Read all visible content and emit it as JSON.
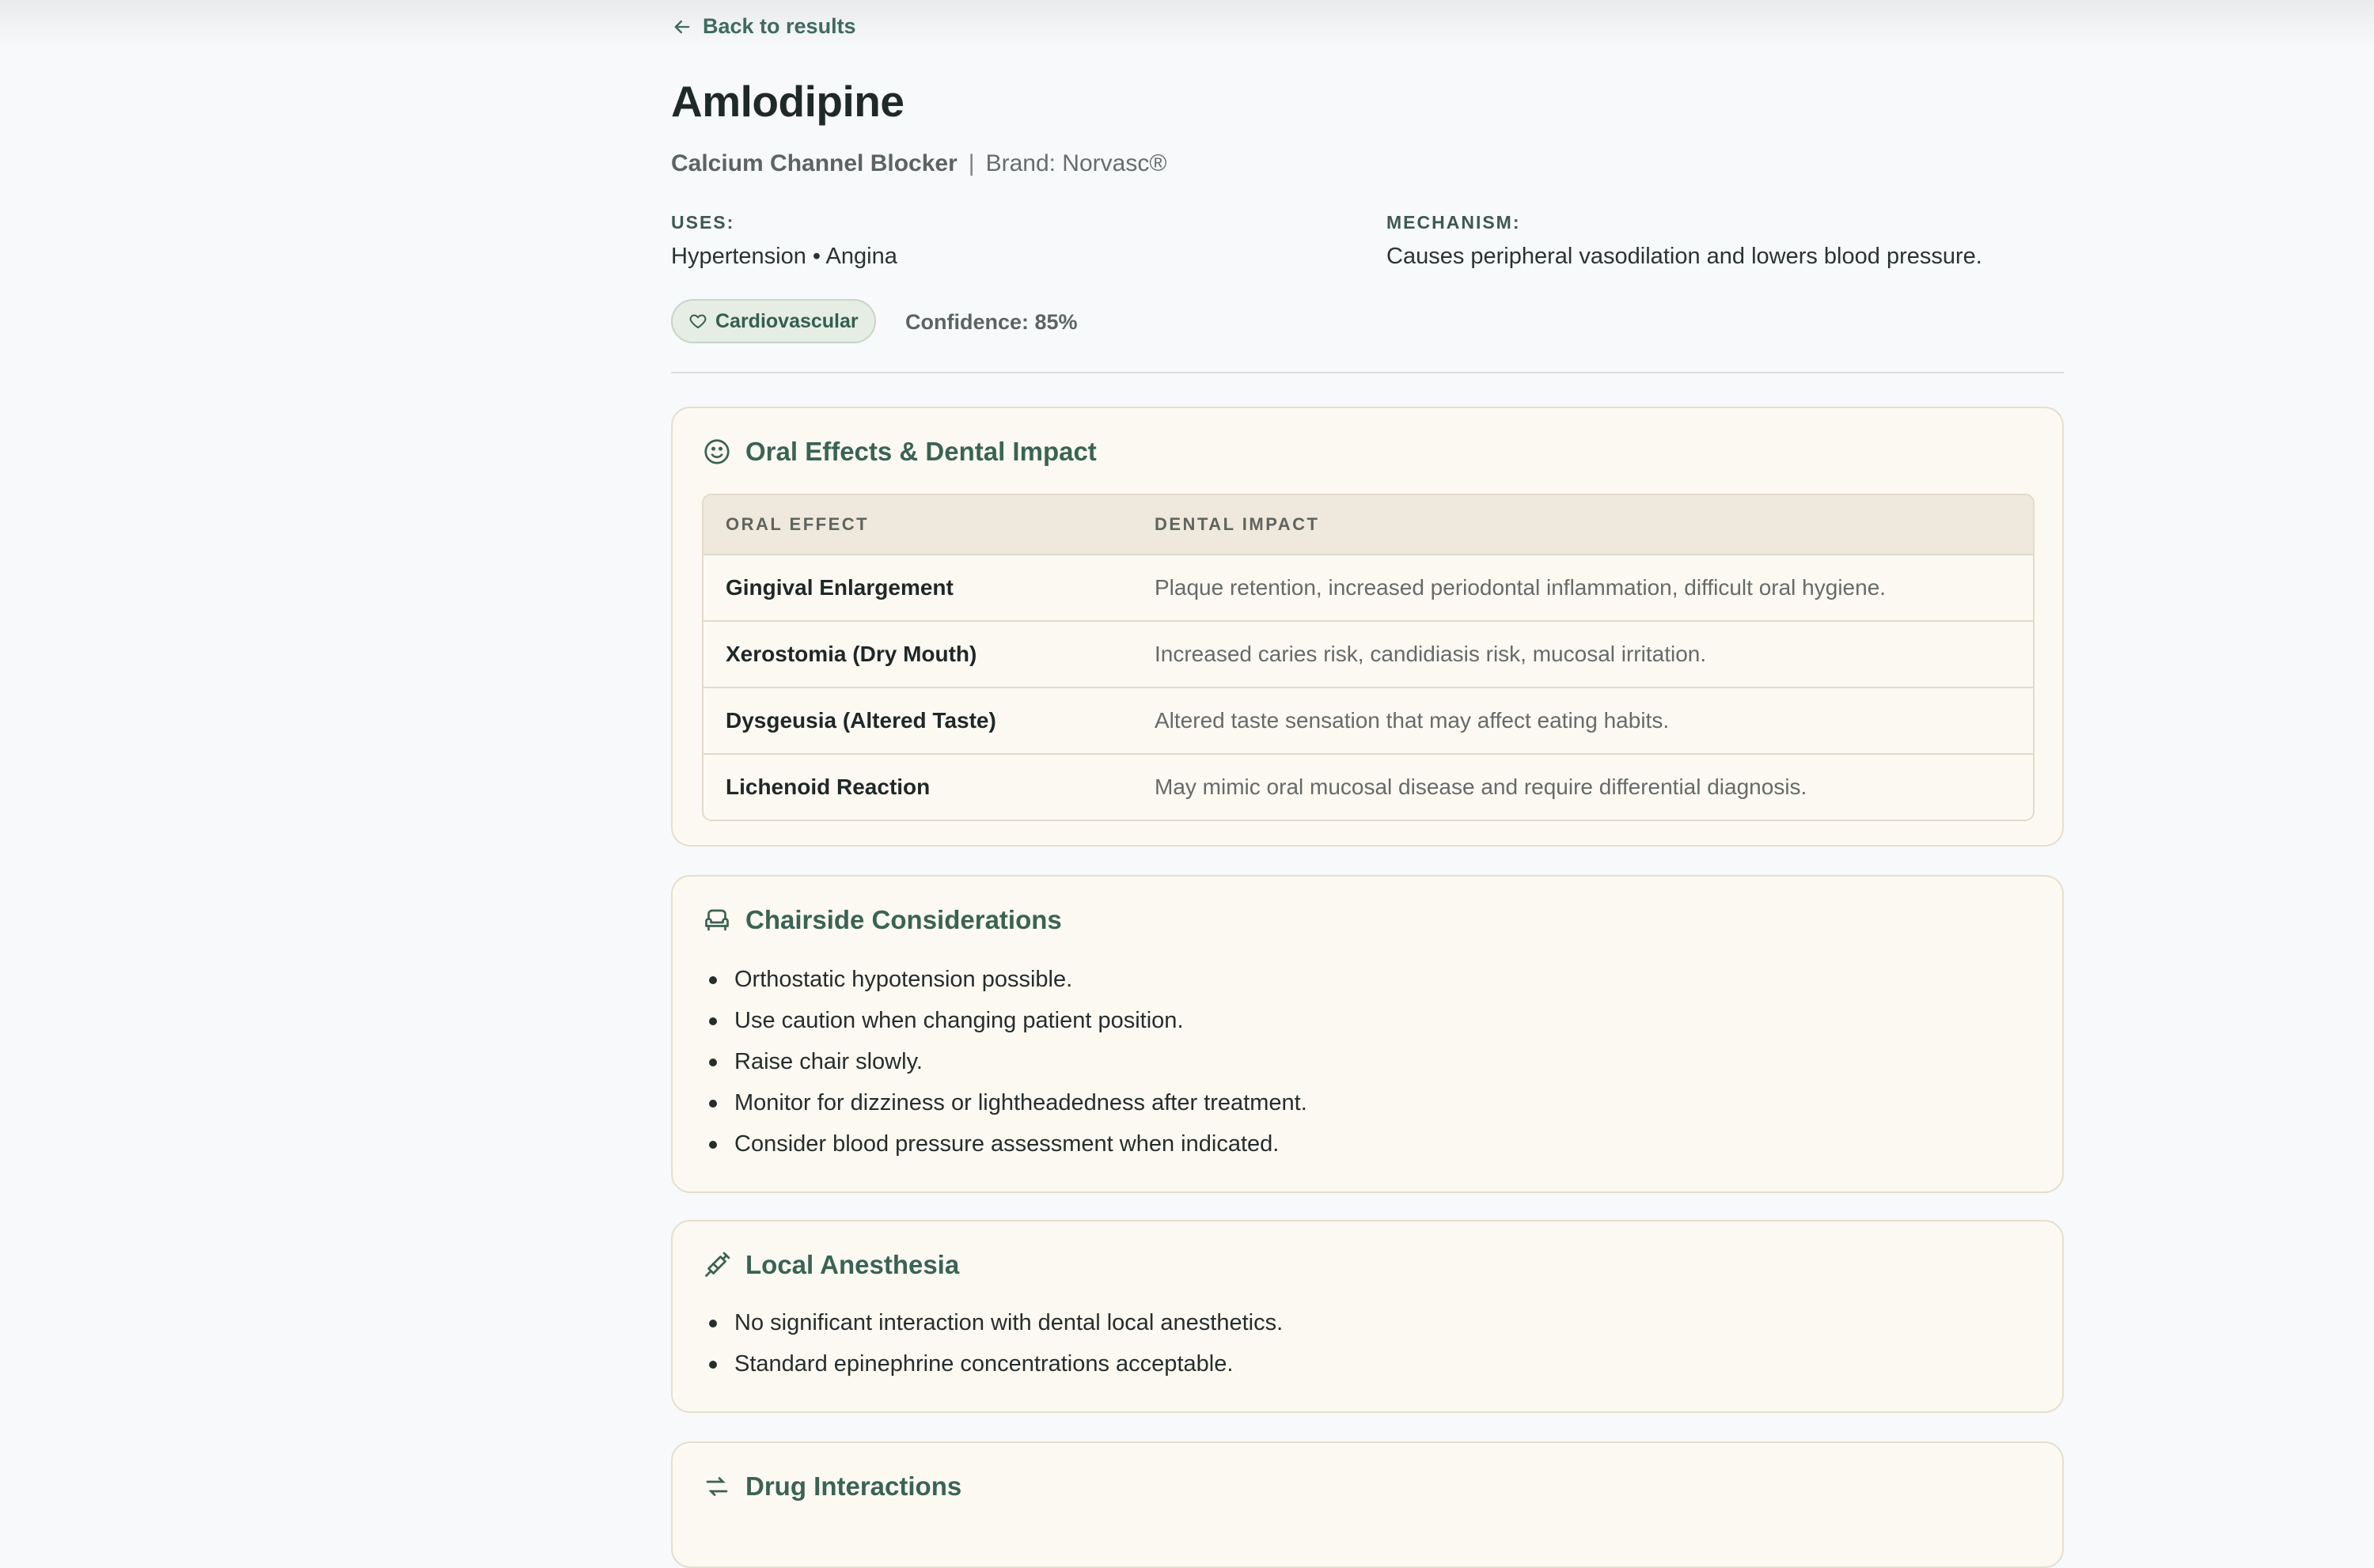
{
  "nav": {
    "back_label": "Back to results"
  },
  "drug": {
    "name": "Amlodipine",
    "drug_class": "Calcium Channel Blocker",
    "separator": "|",
    "brand": "Brand: Norvasc®"
  },
  "uses": {
    "label": "USES:",
    "value": "Hypertension • Angina"
  },
  "mechanism": {
    "label": "MECHANISM:",
    "value": "Causes peripheral vasodilation and lowers blood pressure."
  },
  "tag": {
    "label": "Cardiovascular",
    "icon": "heart-icon"
  },
  "confidence": "Confidence: 85%",
  "oral_effects": {
    "title": "Oral Effects & Dental Impact",
    "icon": "smile-icon",
    "columns": [
      "ORAL EFFECT",
      "DENTAL IMPACT"
    ],
    "rows": [
      {
        "effect": "Gingival Enlargement",
        "impact": "Plaque retention, increased periodontal inflammation, difficult oral hygiene."
      },
      {
        "effect": "Xerostomia (Dry Mouth)",
        "impact": "Increased caries risk, candidiasis risk, mucosal irritation."
      },
      {
        "effect": "Dysgeusia (Altered Taste)",
        "impact": "Altered taste sensation that may affect eating habits."
      },
      {
        "effect": "Lichenoid Reaction",
        "impact": "May mimic oral mucosal disease and require differential diagnosis."
      }
    ]
  },
  "chairside": {
    "title": "Chairside Considerations",
    "icon": "armchair-icon",
    "items": [
      "Orthostatic hypotension possible.",
      "Use caution when changing patient position.",
      "Raise chair slowly.",
      "Monitor for dizziness or lightheadedness after treatment.",
      "Consider blood pressure assessment when indicated."
    ]
  },
  "anesthesia": {
    "title": "Local Anesthesia",
    "icon": "syringe-icon",
    "items": [
      "No significant interaction with dental local anesthetics.",
      "Standard epinephrine concentrations acceptable."
    ]
  },
  "next_section": {
    "title": "Drug Interactions"
  }
}
